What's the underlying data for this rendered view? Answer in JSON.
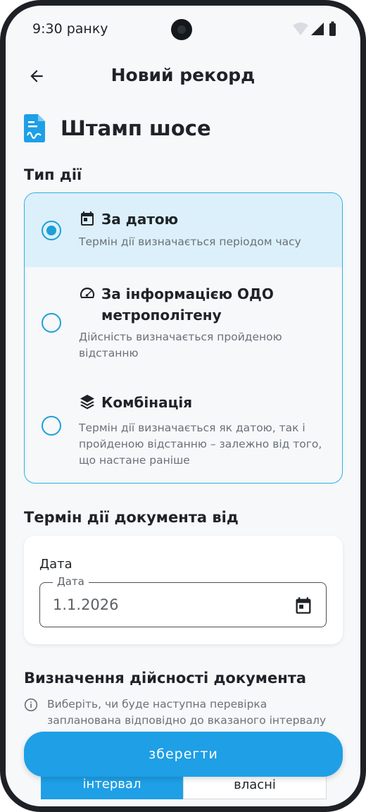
{
  "status_bar": {
    "time": "9:30 ранку"
  },
  "app_bar": {
    "title": "Новий рекорд"
  },
  "document": {
    "title": "Штамп шосе"
  },
  "action_type": {
    "label": "Тип дії",
    "options": [
      {
        "title": "За датою",
        "description": "Термін дії визначається періодом часу",
        "selected": true,
        "icon": "calendar-icon"
      },
      {
        "title": "За інформацією ОДО метрополітену",
        "description": "Дійсність визначається пройденою відстанню",
        "selected": false,
        "icon": "speedometer-icon"
      },
      {
        "title": "Комбінація",
        "description": "Термін дії визначається як датою, так і пройденою відстанню – залежно від того, що настане раніше",
        "selected": false,
        "icon": "layers-icon"
      }
    ]
  },
  "validity_from": {
    "label": "Термін дії документа від",
    "card_label": "Дата",
    "field_legend": "Дата",
    "field_value": "1.1.2026"
  },
  "validity_definition": {
    "label": "Визначення дійсності документа",
    "info": "Виберіть, чи буде наступна перевірка запланована відповідно до вказаного інтервалу чи відповідно до",
    "segments": [
      "інтервал",
      "власні"
    ]
  },
  "save_button": {
    "label": "зберегти"
  },
  "colors": {
    "accent": "#1e9fe6",
    "selected_bg": "#dcf0fb",
    "border": "#2bb0e2"
  }
}
